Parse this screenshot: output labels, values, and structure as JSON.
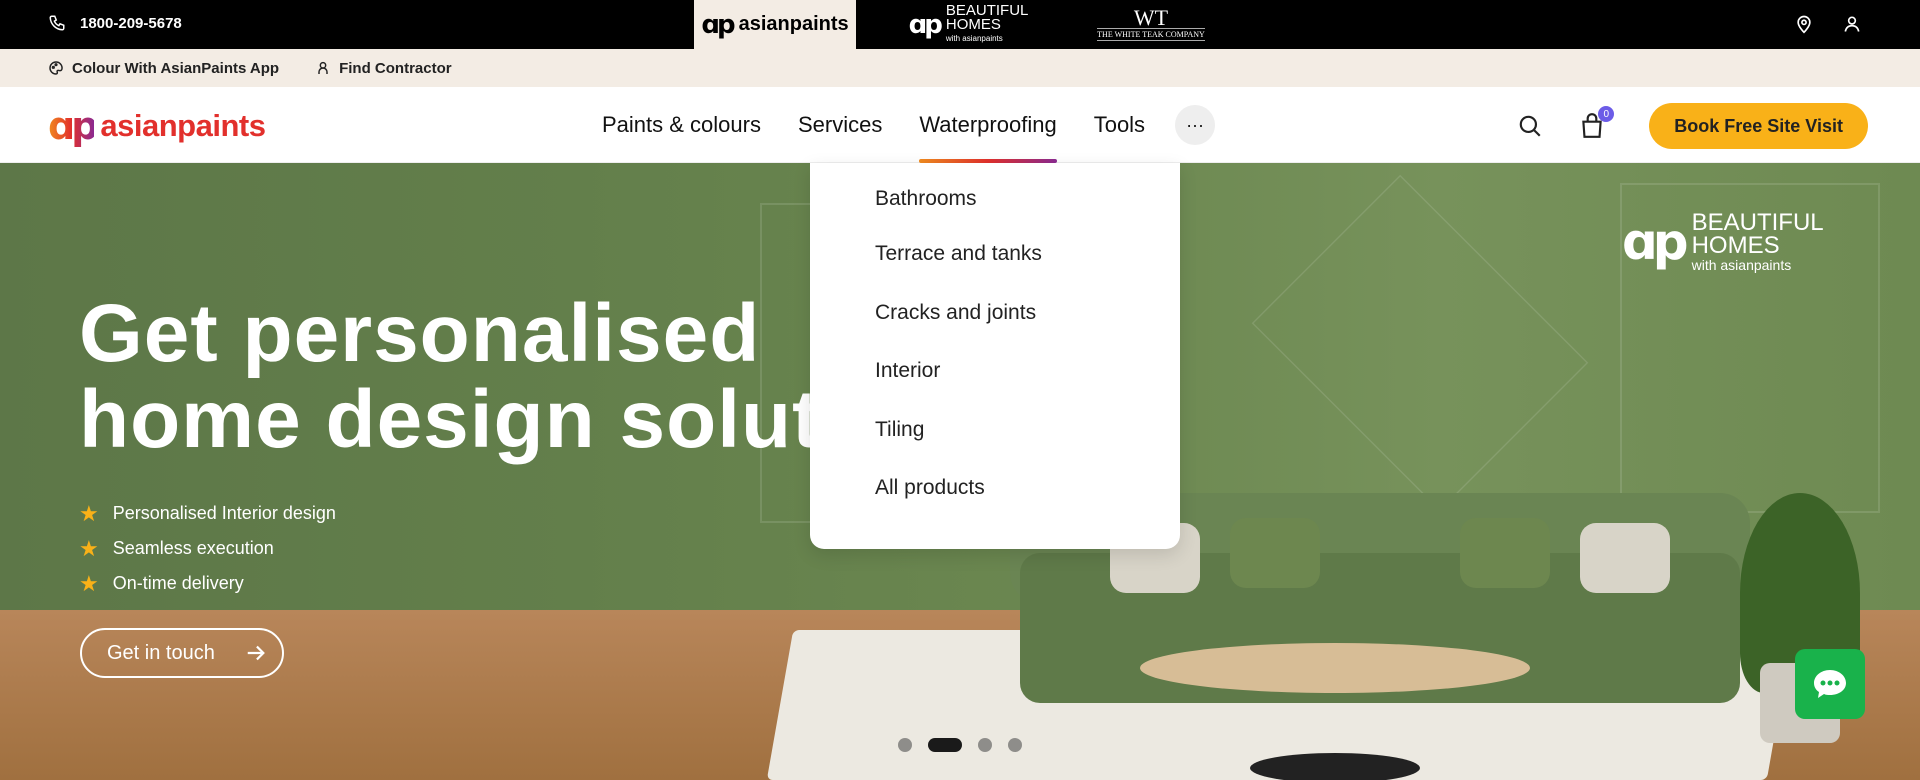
{
  "topbar": {
    "phone": "1800-209-5678",
    "brands": [
      {
        "name": "asianpaints",
        "active": true
      },
      {
        "name_line1": "BEAUTIFUL",
        "name_line2": "HOMES",
        "name_line3": "with asianpaints"
      },
      {
        "monogram": "WT",
        "name": "THE WHITE TEAK COMPANY"
      }
    ],
    "right_icons": [
      "location-icon",
      "user-icon"
    ]
  },
  "subbar": {
    "app_link": "Colour With AsianPaints App",
    "contractor_link": "Find Contractor"
  },
  "nav": {
    "logo_text": "asianpaints",
    "links": [
      "Paints & colours",
      "Services",
      "Waterproofing",
      "Tools"
    ],
    "active_link": "Waterproofing",
    "more_label": "···",
    "cart_count": "0",
    "cta_label": "Book Free Site Visit",
    "accent_color": "#f9b118"
  },
  "dropdown": {
    "items": [
      "Bathrooms",
      "Terrace and tanks",
      "Cracks and joints",
      "Interior",
      "Tiling",
      "All products"
    ]
  },
  "hero": {
    "title_line1": "Get personalised",
    "title_line2": "home design solutions",
    "features": [
      "Personalised Interior design",
      "Seamless execution",
      "On-time delivery"
    ],
    "cta_label": "Get in touch",
    "brand_line1": "BEAUTIFUL",
    "brand_line2": "HOMES",
    "brand_line3": "with asianpaints",
    "slides_total": 4,
    "active_slide": 2
  }
}
